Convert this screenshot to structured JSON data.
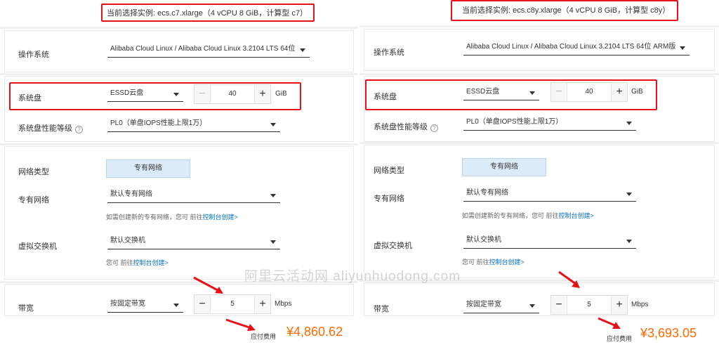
{
  "left": {
    "instance_text": "当前选择实例: ecs.c7.xlarge（4 vCPU 8 GiB，计算型 c7）",
    "os_label": "操作系统",
    "os_value": "Alibaba Cloud Linux / Alibaba Cloud Linux 3.2104 LTS 64位",
    "disk_label": "系统盘",
    "disk_type": "ESSD云盘",
    "disk_size": "40",
    "disk_unit": "GiB",
    "perf_label": "系统盘性能等级",
    "perf_value": "PL0（单盘IOPS性能上限1万）",
    "net_type_label": "网络类型",
    "net_type_value": "专有网络",
    "vpc_label": "专有网络",
    "vpc_value": "默认专有网络",
    "vpc_hint_prefix": "如需创建新的专有网络，您可 前往",
    "vpc_hint_link": "控制台创建>",
    "vswitch_label": "虚拟交换机",
    "vswitch_value": "默认交换机",
    "vswitch_hint_prefix": "您可 前往",
    "vswitch_hint_link": "控制台创建>",
    "bw_label": "带宽",
    "bw_mode": "按固定带宽",
    "bw_value": "5",
    "bw_unit": "Mbps",
    "fee_label": "应付费用",
    "fee_value": "¥4,860.62"
  },
  "right": {
    "instance_text": "当前选择实例: ecs.c8y.xlarge（4 vCPU 8 GiB，计算型 c8y）",
    "os_label": "操作系统",
    "os_value": "Alibaba Cloud Linux / Alibaba Cloud Linux 3.2104 LTS 64位 ARM版",
    "disk_label": "系统盘",
    "disk_type": "ESSD云盘",
    "disk_size": "40",
    "disk_unit": "GiB",
    "perf_label": "系统盘性能等级",
    "perf_value": "PL0（单盘IOPS性能上限1万）",
    "net_type_label": "网络类型",
    "net_type_value": "专有网络",
    "vpc_label": "专有网络",
    "vpc_value": "默认专有网络",
    "vpc_hint_prefix": "如需创建新的专有网络，您可 前往",
    "vpc_hint_link": "控制台创建>",
    "vswitch_label": "虚拟交换机",
    "vswitch_value": "默认交换机",
    "vswitch_hint_prefix": "您可 前往",
    "vswitch_hint_link": "控制台创建>",
    "bw_label": "带宽",
    "bw_mode": "按固定带宽",
    "bw_value": "5",
    "bw_unit": "Mbps",
    "fee_label": "应付费用",
    "fee_value": "¥3,693.05"
  },
  "icons": {
    "minus": "−",
    "plus": "+",
    "help": "?"
  },
  "watermark": "阿里云活动网 aliyunhuodong.com",
  "colors": {
    "highlight_red": "#e8111a",
    "price_orange": "#ff6a00",
    "link_blue": "#0070cc",
    "segment_bg": "#dcebf8"
  }
}
